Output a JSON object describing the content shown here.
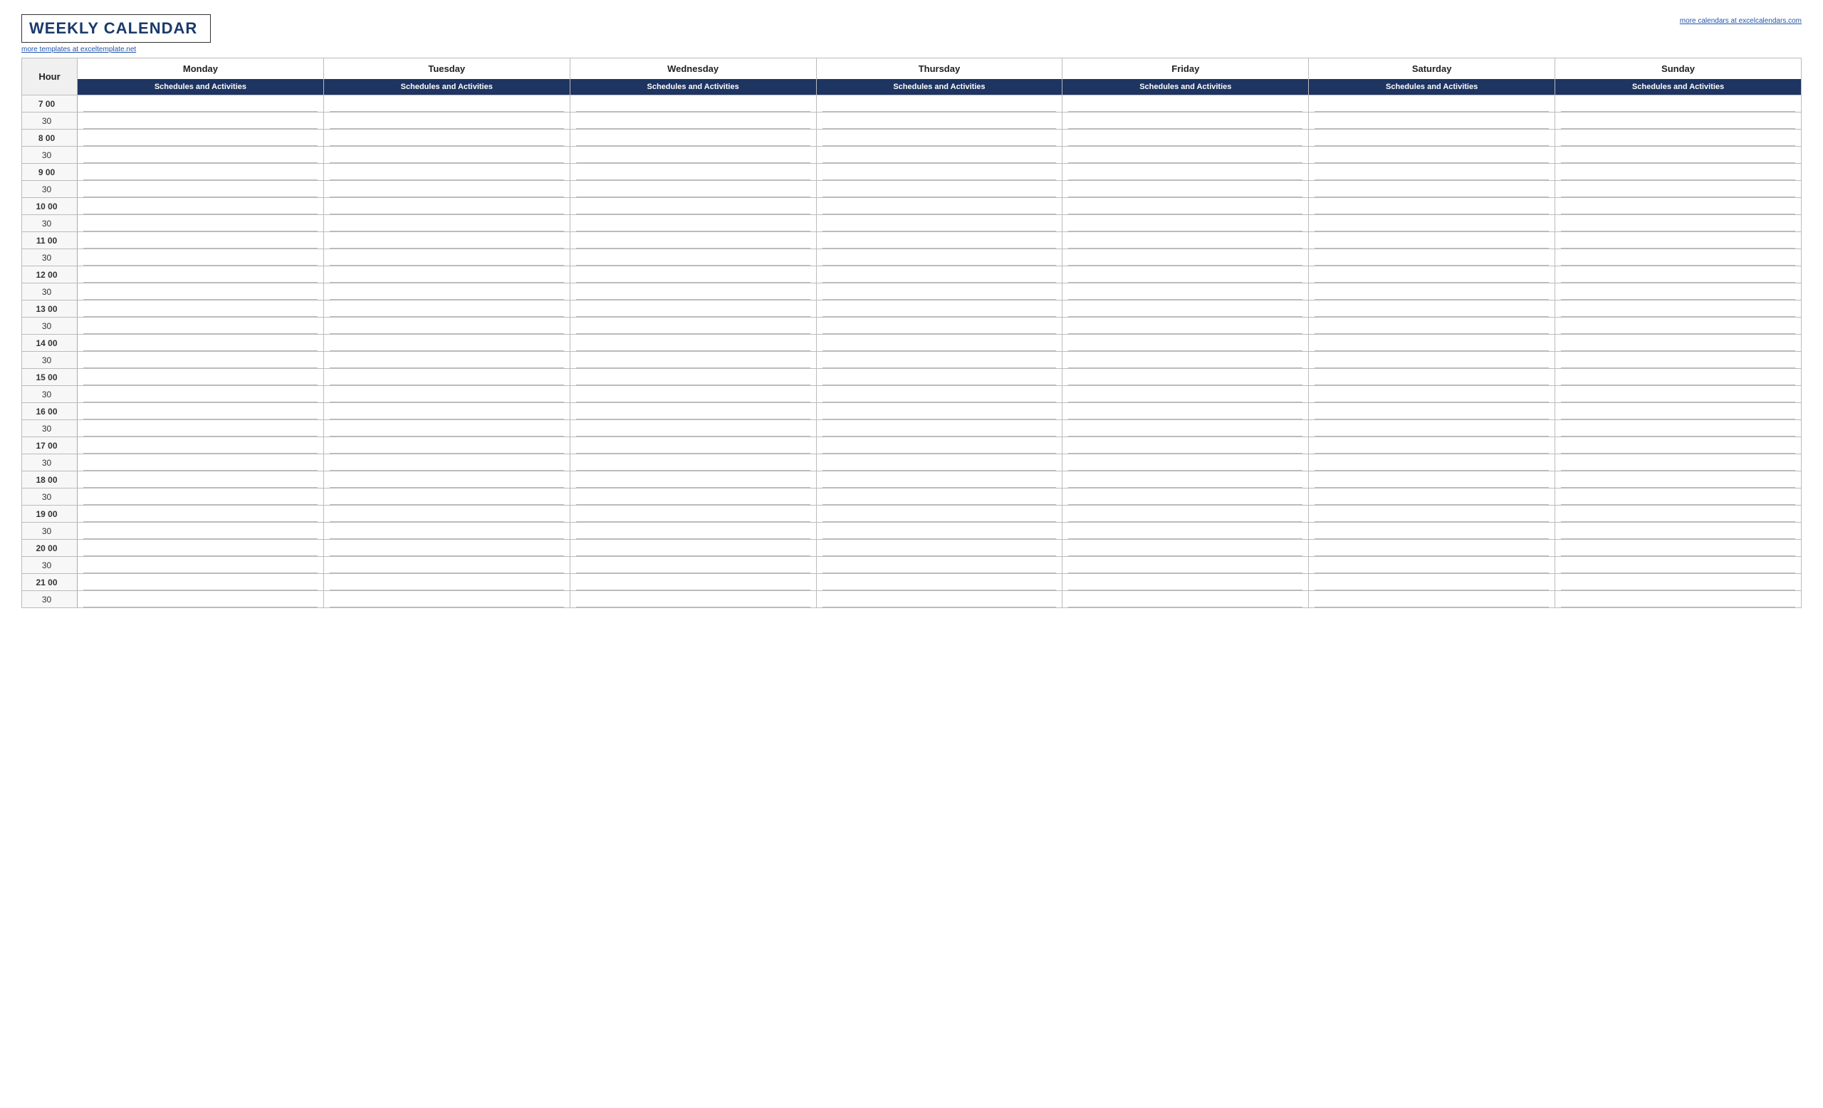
{
  "title": "WEEKLY CALENDAR",
  "watermark_left": "more templates at exceltemplate.net",
  "watermark_right": "more calendars at excelcalendars.com",
  "hour_label": "Hour",
  "days": [
    "Monday",
    "Tuesday",
    "Wednesday",
    "Thursday",
    "Friday",
    "Saturday",
    "Sunday"
  ],
  "schedules_label": "Schedules and Activities",
  "time_slots": [
    {
      "hour": "7",
      "minute": "00",
      "major": true
    },
    {
      "hour": "",
      "minute": "30",
      "major": false
    },
    {
      "hour": "8",
      "minute": "00",
      "major": true
    },
    {
      "hour": "",
      "minute": "30",
      "major": false
    },
    {
      "hour": "9",
      "minute": "00",
      "major": true
    },
    {
      "hour": "",
      "minute": "30",
      "major": false
    },
    {
      "hour": "10",
      "minute": "00",
      "major": true
    },
    {
      "hour": "",
      "minute": "30",
      "major": false
    },
    {
      "hour": "11",
      "minute": "00",
      "major": true
    },
    {
      "hour": "",
      "minute": "30",
      "major": false
    },
    {
      "hour": "12",
      "minute": "00",
      "major": true
    },
    {
      "hour": "",
      "minute": "30",
      "major": false
    },
    {
      "hour": "13",
      "minute": "00",
      "major": true
    },
    {
      "hour": "",
      "minute": "30",
      "major": false
    },
    {
      "hour": "14",
      "minute": "00",
      "major": true
    },
    {
      "hour": "",
      "minute": "30",
      "major": false
    },
    {
      "hour": "15",
      "minute": "00",
      "major": true
    },
    {
      "hour": "",
      "minute": "30",
      "major": false
    },
    {
      "hour": "16",
      "minute": "00",
      "major": true
    },
    {
      "hour": "",
      "minute": "30",
      "major": false
    },
    {
      "hour": "17",
      "minute": "00",
      "major": true
    },
    {
      "hour": "",
      "minute": "30",
      "major": false
    },
    {
      "hour": "18",
      "minute": "00",
      "major": true
    },
    {
      "hour": "",
      "minute": "30",
      "major": false
    },
    {
      "hour": "19",
      "minute": "00",
      "major": true
    },
    {
      "hour": "",
      "minute": "30",
      "major": false
    },
    {
      "hour": "20",
      "minute": "00",
      "major": true
    },
    {
      "hour": "",
      "minute": "30",
      "major": false
    },
    {
      "hour": "21",
      "minute": "00",
      "major": true
    },
    {
      "hour": "",
      "minute": "30",
      "major": false
    }
  ]
}
